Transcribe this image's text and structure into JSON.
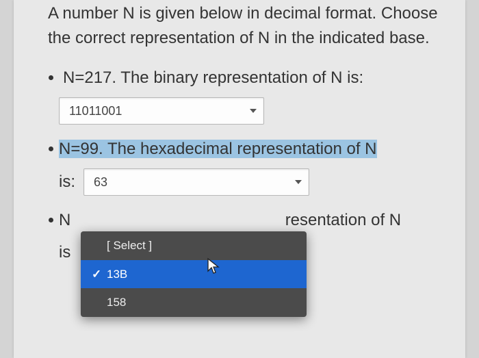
{
  "prompt": "A number N is given below in decimal format. Choose the correct representation of N in the indicated base.",
  "q1": {
    "text": "N=217.  The binary representation of N is:",
    "value": "11011001"
  },
  "q2": {
    "text": "N=99.  The hexadecimal representation of N",
    "is": "is:",
    "value": "63"
  },
  "q3": {
    "leading": "N",
    "trailing": "resentation of N",
    "is": "is",
    "options": {
      "placeholder": "[ Select ]",
      "selected": "13B",
      "other": "158"
    }
  }
}
